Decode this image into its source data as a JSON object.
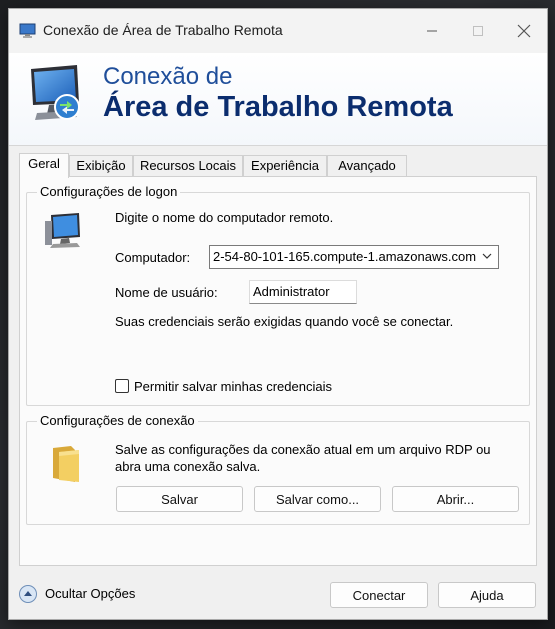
{
  "window": {
    "title": "Conexão de Área de Trabalho Remota",
    "controls": {
      "minimize": "—",
      "maximize": "☐",
      "close": "✕"
    }
  },
  "banner": {
    "line1": "Conexão de",
    "line2": "Área de Trabalho Remota",
    "icon": "remote-desktop-monitor-icon"
  },
  "tabs": [
    {
      "label": "Geral",
      "active": true
    },
    {
      "label": "Exibição",
      "active": false
    },
    {
      "label": "Recursos Locais",
      "active": false
    },
    {
      "label": "Experiência",
      "active": false
    },
    {
      "label": "Avançado",
      "active": false
    }
  ],
  "logon": {
    "legend": "Configurações de logon",
    "instruction": "Digite o nome do computador remoto.",
    "computer_label": "Computador:",
    "computer_value": "2-54-80-101-165.compute-1.amazonaws.com",
    "username_label": "Nome de usuário:",
    "username_value": "Administrator",
    "credentials_note": "Suas credenciais serão exigidas quando você se conectar.",
    "save_credentials_label": "Permitir salvar minhas credenciais",
    "save_credentials_checked": false
  },
  "connection": {
    "legend": "Configurações de conexão",
    "description_line1": "Salve as configurações da conexão atual em um arquivo RDP ou",
    "description_line2": "abra uma conexão salva.",
    "save_button": "Salvar",
    "save_as_button": "Salvar como...",
    "open_button": "Abrir..."
  },
  "footer": {
    "hide_options": "Ocultar Opções",
    "connect_button": "Conectar",
    "help_button": "Ajuda"
  },
  "colors": {
    "banner_title_light": "#1f4e9a",
    "banner_title_dark": "#0b2d6e",
    "window_bg": "#f0f0f0"
  }
}
